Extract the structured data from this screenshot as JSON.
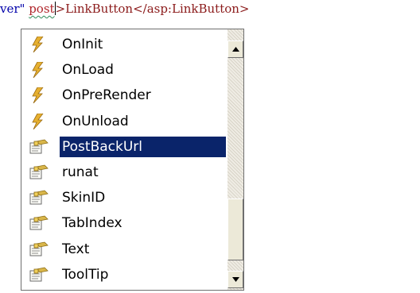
{
  "editor": {
    "before": "ver\" ",
    "typed": "post",
    "tag_text": ">LinkButton</asp:LinkButton>"
  },
  "completion": {
    "items": [
      {
        "label": "OnInit",
        "icon": "event-icon",
        "selected": false
      },
      {
        "label": "OnLoad",
        "icon": "event-icon",
        "selected": false
      },
      {
        "label": "OnPreRender",
        "icon": "event-icon",
        "selected": false
      },
      {
        "label": "OnUnload",
        "icon": "event-icon",
        "selected": false
      },
      {
        "label": "PostBackUrl",
        "icon": "property-icon",
        "selected": true
      },
      {
        "label": "runat",
        "icon": "property-icon",
        "selected": false
      },
      {
        "label": "SkinID",
        "icon": "property-icon",
        "selected": false
      },
      {
        "label": "TabIndex",
        "icon": "property-icon",
        "selected": false
      },
      {
        "label": "Text",
        "icon": "property-icon",
        "selected": false
      },
      {
        "label": "ToolTip",
        "icon": "property-icon",
        "selected": false
      }
    ],
    "selection_color": "#0a246a"
  }
}
